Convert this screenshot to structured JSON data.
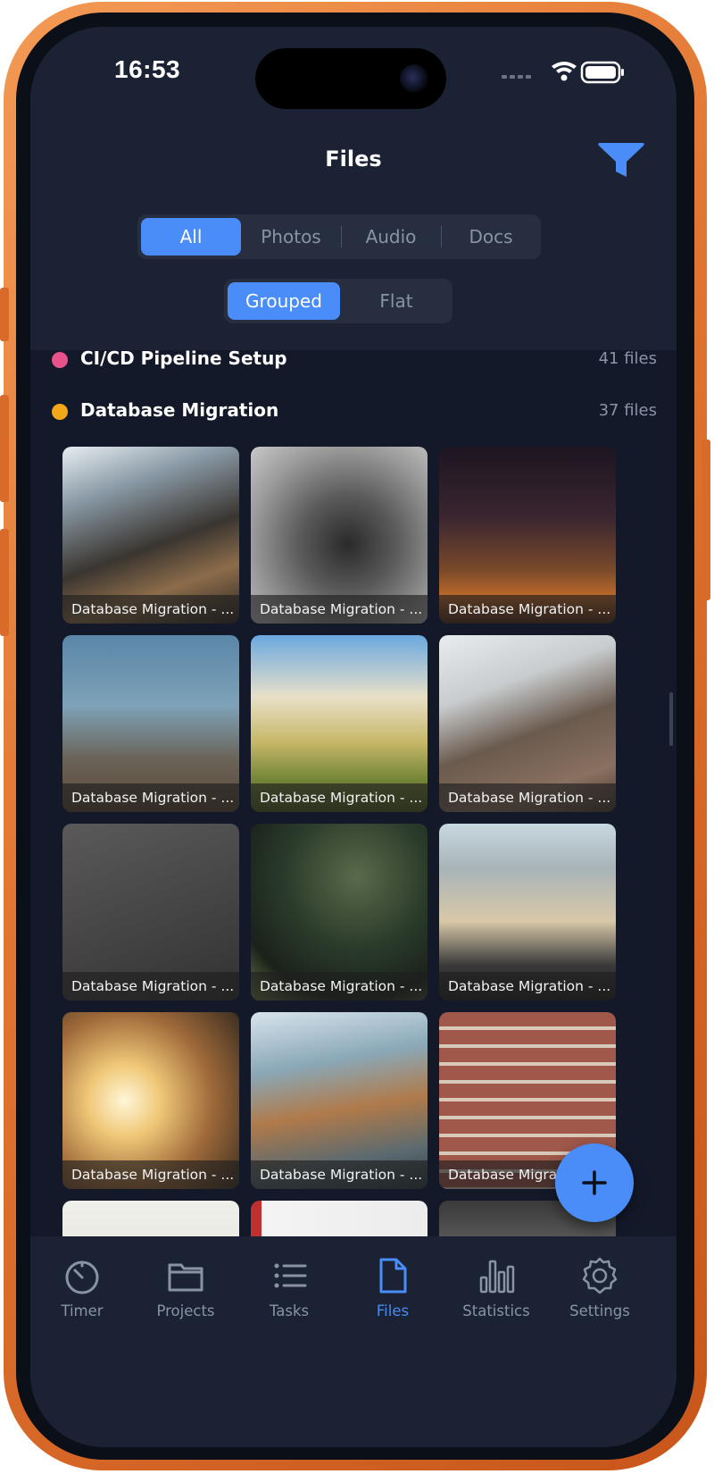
{
  "status_bar": {
    "time": "16:53"
  },
  "header": {
    "title": "Files"
  },
  "filters": {
    "type_tabs": [
      "All",
      "Photos",
      "Audio",
      "Docs"
    ],
    "type_selected": "All",
    "view_tabs": [
      "Grouped",
      "Flat"
    ],
    "view_selected": "Grouped"
  },
  "groups": [
    {
      "name": "CI/CD Pipeline Setup",
      "count": "41 files",
      "color": "#e8528a"
    },
    {
      "name": "Database Migration",
      "count": "37 files",
      "color": "#f4a718"
    }
  ],
  "photos": [
    {
      "caption": "Database Migration - ..."
    },
    {
      "caption": "Database Migration - ..."
    },
    {
      "caption": "Database Migration - ..."
    },
    {
      "caption": "Database Migration - ..."
    },
    {
      "caption": "Database Migration - ..."
    },
    {
      "caption": "Database Migration - ..."
    },
    {
      "caption": "Database Migration - ..."
    },
    {
      "caption": "Database Migration - ..."
    },
    {
      "caption": "Database Migration - ..."
    },
    {
      "caption": "Database Migration - ..."
    },
    {
      "caption": "Database Migration - ..."
    },
    {
      "caption": "Database Migration - ..."
    }
  ],
  "tab_bar": [
    {
      "label": "Timer",
      "icon": "timer-icon"
    },
    {
      "label": "Projects",
      "icon": "folder-icon"
    },
    {
      "label": "Tasks",
      "icon": "list-icon"
    },
    {
      "label": "Files",
      "icon": "file-icon",
      "active": true
    },
    {
      "label": "Statistics",
      "icon": "bar-chart-icon"
    },
    {
      "label": "Settings",
      "icon": "gear-icon"
    }
  ],
  "colors": {
    "accent": "#4a8cf8",
    "background": "#14192a",
    "surface": "#1b2233"
  }
}
